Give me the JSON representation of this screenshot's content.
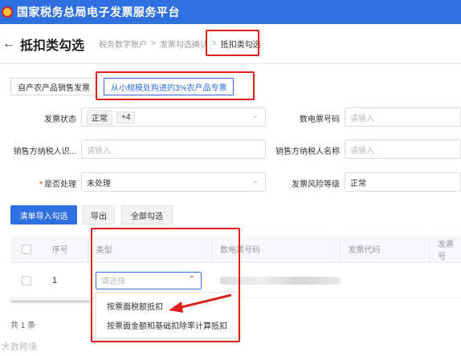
{
  "app": {
    "title": "国家税务总局电子发票服务平台"
  },
  "header": {
    "back_symbol": "←",
    "page_title": "抵扣类勾选",
    "breadcrumb": [
      "税务数字账户",
      "发票勾选确认",
      "抵扣类勾选"
    ],
    "breadcrumb_sep": ">"
  },
  "tabs": [
    {
      "label": "自产农产品销售发票",
      "active": false
    },
    {
      "label": "从小规模处购进的3%农产品专票",
      "active": true
    }
  ],
  "filters": {
    "invoice_status": {
      "label": "发票状态",
      "tag": "正常",
      "more": "+4"
    },
    "einvoice_no": {
      "label": "数电票号码",
      "placeholder": "请输入"
    },
    "seller_taxid": {
      "label": "销售方纳税人识...",
      "placeholder": "请输入"
    },
    "seller_name": {
      "label": "销售方纳税人名称",
      "placeholder": "请输入"
    },
    "processed": {
      "required_mark": "*",
      "label": "是否处理",
      "value": "未处理"
    },
    "risk_level": {
      "label": "发票风险等级",
      "value": "正常"
    }
  },
  "actions": {
    "import_select": "清单导入勾选",
    "export": "导出",
    "select_all": "全部勾选"
  },
  "table": {
    "columns": [
      "序号",
      "类型",
      "数电票号码",
      "发票代码",
      "发票号"
    ],
    "rows": [
      {
        "index": "1",
        "type_placeholder": "请选择"
      }
    ]
  },
  "dropdown": {
    "options": [
      "按票面税额抵扣",
      "按票面金额和基础扣除率计算抵扣"
    ]
  },
  "footer": {
    "total": "共 1 条"
  },
  "watermark": "大数跨境",
  "icons": {
    "chevron": "⌄",
    "chevron_up": "⌃",
    "arrow": "↑"
  },
  "colors": {
    "brand": "#2f6fe0",
    "highlight": "#e01e1e"
  }
}
